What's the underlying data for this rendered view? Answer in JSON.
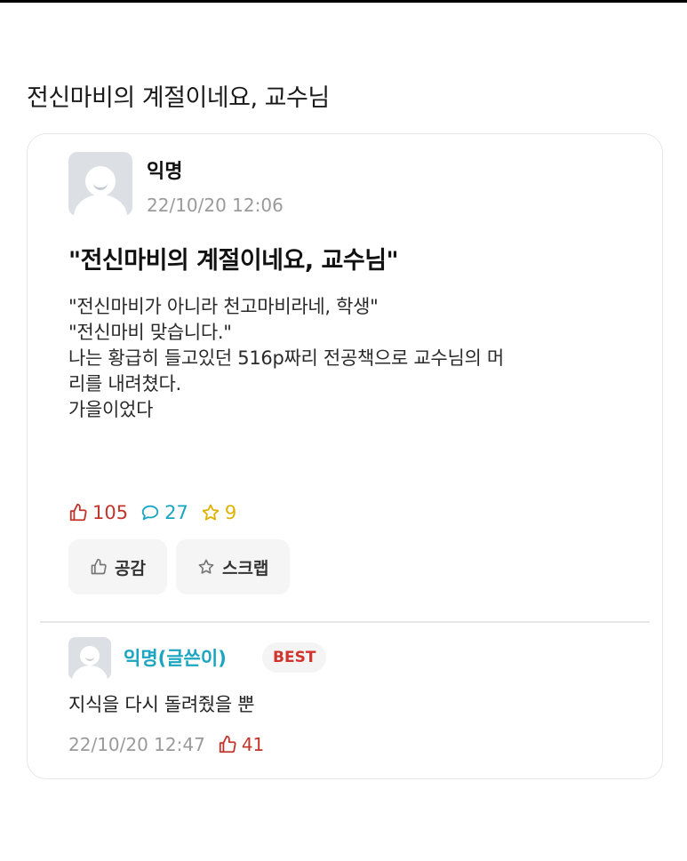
{
  "page": {
    "title": "전신마비의 계절이네요, 교수님"
  },
  "post": {
    "author": "익명",
    "timestamp": "22/10/20 12:06",
    "title": "\"전신마비의 계절이네요, 교수님\"",
    "body_lines": [
      "\"전신마비가 아니라 천고마비라네, 학생\"",
      "\"전신마비 맞습니다.\"",
      "나는 황급히 들고있던 516p짜리 전공책으로 교수님의 머",
      "리를 내려쳤다.",
      "",
      "가을이었다"
    ],
    "stats": {
      "likes": "105",
      "comments": "27",
      "scraps": "9"
    },
    "actions": {
      "like_label": "공감",
      "scrap_label": "스크랩"
    }
  },
  "comment": {
    "author": "익명(글쓴이)",
    "badge": "BEST",
    "text": "지식을 다시 돌려줬을 뿐",
    "timestamp": "22/10/20 12:47",
    "likes": "41"
  },
  "colors": {
    "like": "#c3352b",
    "comment": "#1aa5c0",
    "scrap": "#e0b200",
    "badge_text": "#d0342c"
  },
  "icons": {
    "like": "thumbs-up-icon",
    "comment": "speech-bubble-icon",
    "scrap": "star-icon",
    "avatar": "user-avatar-icon"
  }
}
